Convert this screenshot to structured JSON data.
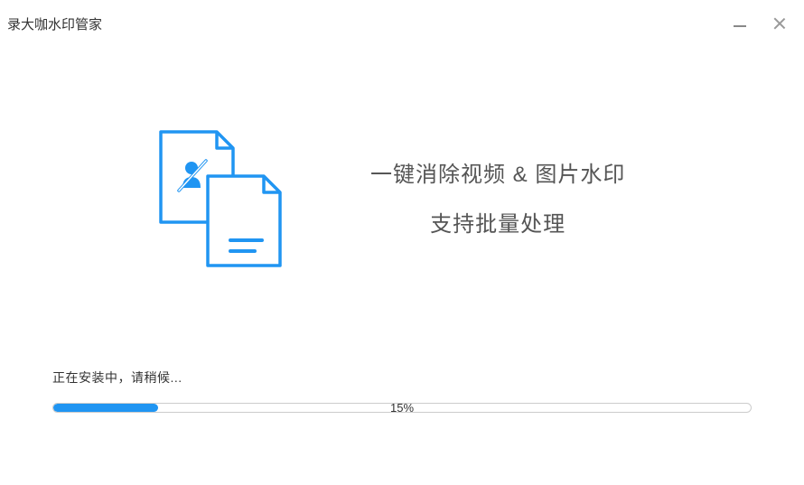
{
  "window": {
    "title": "录大咖水印管家"
  },
  "feature": {
    "line1": "一键消除视频 & 图片水印",
    "line2": "支持批量处理"
  },
  "install": {
    "status_text": "正在安装中，请稍候...",
    "percent_text": "15%",
    "percent_value": 15
  },
  "colors": {
    "accent": "#2095f2"
  }
}
